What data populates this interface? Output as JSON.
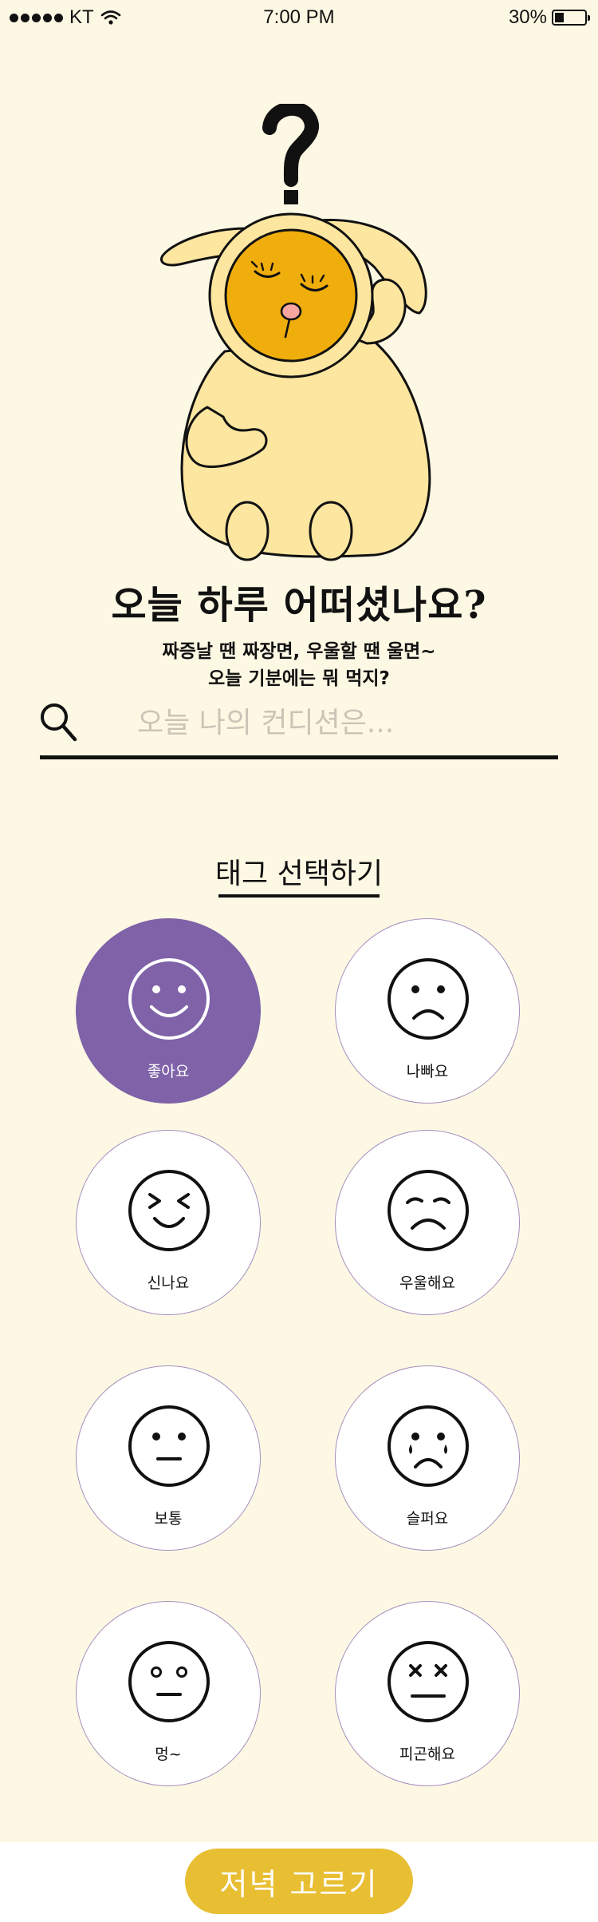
{
  "status_bar": {
    "carrier": "KT",
    "time": "7:00 PM",
    "battery": "30%",
    "battery_level": 0.3
  },
  "hero": {
    "title": "오늘 하루 어떠셨나요?",
    "subtitle_line1": "짜증날 땐 짜장면, 우울할 땐 울면~",
    "subtitle_line2": "오늘 기분에는 뭐 먹지?"
  },
  "search": {
    "placeholder": "오늘 나의 컨디션은..."
  },
  "tags": {
    "header": "태그 선택하기",
    "items": [
      {
        "label": "좋아요",
        "icon": "smile-face-icon",
        "selected": true
      },
      {
        "label": "나빠요",
        "icon": "frown-face-icon",
        "selected": false
      },
      {
        "label": "신나요",
        "icon": "excited-face-icon",
        "selected": false
      },
      {
        "label": "우울해요",
        "icon": "gloomy-face-icon",
        "selected": false
      },
      {
        "label": "보통",
        "icon": "neutral-face-icon",
        "selected": false
      },
      {
        "label": "슬퍼요",
        "icon": "crying-face-icon",
        "selected": false
      },
      {
        "label": "멍~",
        "icon": "blank-face-icon",
        "selected": false
      },
      {
        "label": "피곤해요",
        "icon": "tired-face-icon",
        "selected": false
      }
    ]
  },
  "cta": {
    "label": "저녁 고르기"
  },
  "colors": {
    "background": "#fdf8e3",
    "selected_tag": "#7f62a8",
    "cta": "#e8be33",
    "mascot_body": "#fde6a0",
    "mascot_face": "#f0ae0c"
  }
}
